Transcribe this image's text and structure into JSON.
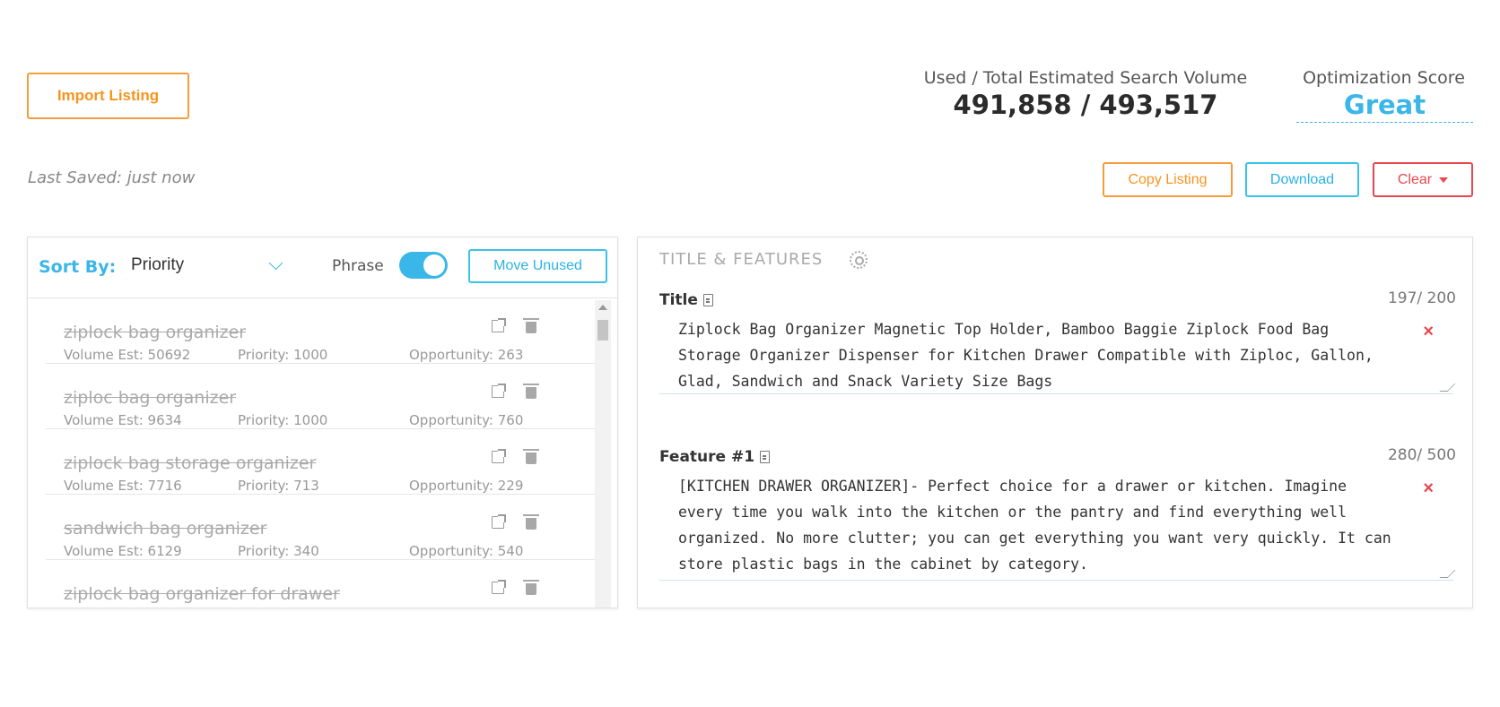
{
  "header": {
    "import_label": "Import Listing",
    "volume_label": "Used / Total Estimated Search Volume",
    "volume_value": "491,858 / 493,517",
    "score_label": "Optimization Score",
    "score_value": "Great",
    "last_saved": "Last Saved: just now",
    "copy_label": "Copy Listing",
    "download_label": "Download",
    "clear_label": "Clear"
  },
  "keywords_panel": {
    "sort_label": "Sort By:",
    "sort_value": "Priority",
    "phrase_label": "Phrase",
    "phrase_toggle_on": true,
    "move_unused_label": "Move Unused",
    "items": [
      {
        "phrase": "ziplock bag organizer",
        "volume": "Volume Est: 50692",
        "priority": "Priority: 1000",
        "opportunity": "Opportunity: 263"
      },
      {
        "phrase": "ziploc bag organizer",
        "volume": "Volume Est: 9634",
        "priority": "Priority: 1000",
        "opportunity": "Opportunity: 760"
      },
      {
        "phrase": "ziplock bag storage organizer",
        "volume": "Volume Est: 7716",
        "priority": "Priority: 713",
        "opportunity": "Opportunity: 229"
      },
      {
        "phrase": "sandwich bag organizer",
        "volume": "Volume Est: 6129",
        "priority": "Priority: 340",
        "opportunity": "Opportunity: 540"
      },
      {
        "phrase": "ziplock bag organizer for drawer",
        "volume": "",
        "priority": "",
        "opportunity": ""
      }
    ]
  },
  "editor_panel": {
    "section_title": "TITLE & FEATURES",
    "title": {
      "label": "Title",
      "count": "197/ 200",
      "text": "Ziplock Bag Organizer Magnetic Top Holder, Bamboo Baggie Ziplock Food Bag Storage Organizer Dispenser for Kitchen Drawer Compatible with Ziploc, Gallon, Glad, Sandwich and Snack Variety Size Bags"
    },
    "feature1": {
      "label": "Feature #1",
      "count": "280/ 500",
      "text": " [KITCHEN DRAWER ORGANIZER]- Perfect choice for a drawer or kitchen. Imagine every time you walk into the kitchen or the pantry and find everything well organized. No more clutter; you can get everything you want very quickly. It can store plastic bags in the cabinet by category."
    },
    "remove_symbol": "×"
  },
  "colors": {
    "orange": "#f7941d",
    "blue": "#3ab6e8",
    "red": "#e8474f"
  }
}
